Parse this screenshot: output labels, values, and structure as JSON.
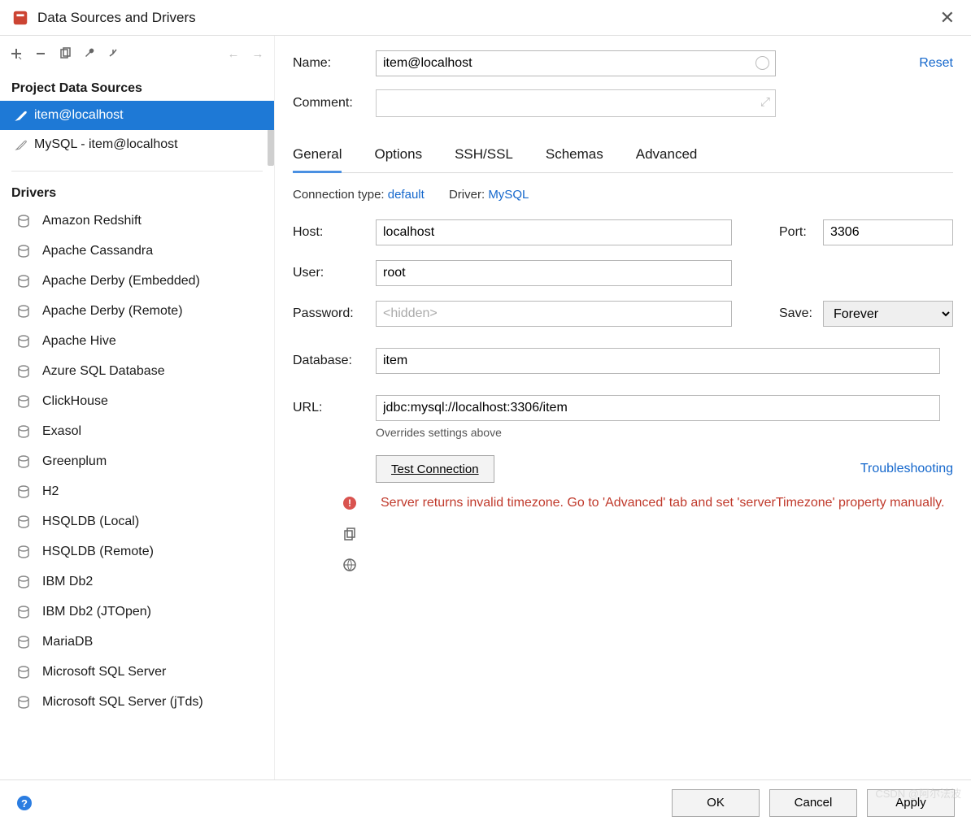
{
  "window": {
    "title": "Data Sources and Drivers"
  },
  "sidebar": {
    "section1": "Project Data Sources",
    "items": [
      {
        "label": "item@localhost",
        "selected": true
      },
      {
        "label": "MySQL - item@localhost",
        "selected": false
      }
    ],
    "section2": "Drivers",
    "drivers": [
      "Amazon Redshift",
      "Apache Cassandra",
      "Apache Derby (Embedded)",
      "Apache Derby (Remote)",
      "Apache Hive",
      "Azure SQL Database",
      "ClickHouse",
      "Exasol",
      "Greenplum",
      "H2",
      "HSQLDB (Local)",
      "HSQLDB (Remote)",
      "IBM Db2",
      "IBM Db2 (JTOpen)",
      "MariaDB",
      "Microsoft SQL Server",
      "Microsoft SQL Server (jTds)"
    ]
  },
  "header": {
    "name_label": "Name:",
    "name_value": "item@localhost",
    "comment_label": "Comment:",
    "reset": "Reset"
  },
  "tabs": [
    "General",
    "Options",
    "SSH/SSL",
    "Schemas",
    "Advanced"
  ],
  "conn_line": {
    "conn_type_k": "Connection type:",
    "conn_type_v": "default",
    "driver_k": "Driver:",
    "driver_v": "MySQL"
  },
  "form": {
    "host_l": "Host:",
    "host_v": "localhost",
    "port_l": "Port:",
    "port_v": "3306",
    "user_l": "User:",
    "user_v": "root",
    "pwd_l": "Password:",
    "pwd_ph": "<hidden>",
    "save_l": "Save:",
    "save_v": "Forever",
    "db_l": "Database:",
    "db_v": "item",
    "url_l": "URL:",
    "url_v": "jdbc:mysql://localhost:3306/item",
    "url_note": "Overrides settings above"
  },
  "test": {
    "btn": "Test Connection",
    "troubleshoot": "Troubleshooting",
    "error": "Server returns invalid timezone. Go to 'Advanced' tab and set 'serverTimezone' property manually."
  },
  "footer": {
    "ok": "OK",
    "cancel": "Cancel",
    "apply": "Apply"
  },
  "watermark": "CSDN @阿尔法波"
}
